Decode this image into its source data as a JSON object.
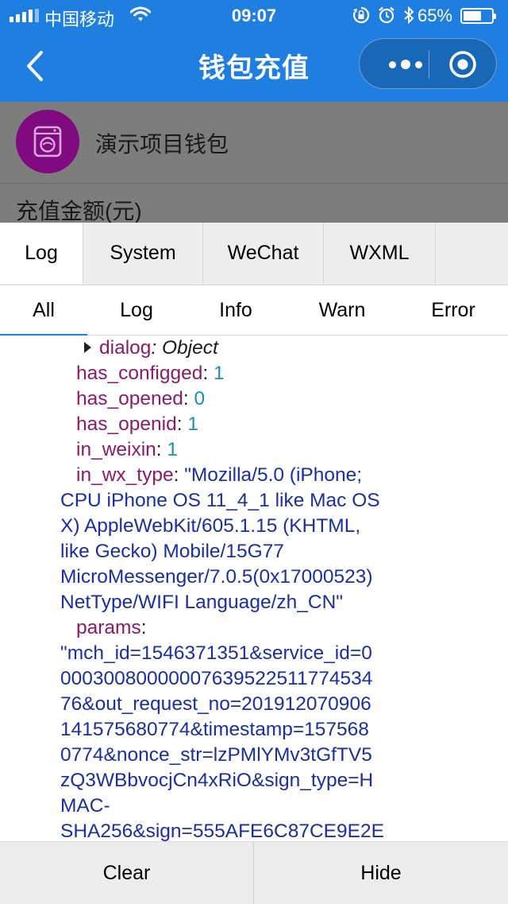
{
  "status_bar": {
    "carrier": "中国移动",
    "time": "09:07",
    "battery_percent": "65%",
    "battery_level": 0.65,
    "icons": [
      "signal-icon",
      "wifi-icon",
      "rotation-lock-icon",
      "alarm-icon",
      "bluetooth-icon",
      "battery-icon"
    ]
  },
  "nav": {
    "title": "钱包充值",
    "back_icon": "chevron-left-icon",
    "more_icon": "more-dots-icon",
    "close_icon": "target-circle-icon"
  },
  "page": {
    "wallet_name": "演示项目钱包",
    "amount_label": "充值金额(元)"
  },
  "vconsole": {
    "tabs": [
      {
        "label": "Log"
      },
      {
        "label": "System"
      },
      {
        "label": "WeChat"
      },
      {
        "label": "WXML"
      }
    ],
    "subtabs": [
      {
        "label": "All"
      },
      {
        "label": "Log"
      },
      {
        "label": "Info"
      },
      {
        "label": "Warn"
      },
      {
        "label": "Error"
      }
    ],
    "log": {
      "dialog_key": "dialog",
      "dialog_type": ": Object",
      "entries": [
        {
          "key": "has_configged",
          "value": "1"
        },
        {
          "key": "has_opened",
          "value": "0"
        },
        {
          "key": "has_openid",
          "value": "1"
        },
        {
          "key": "in_weixin",
          "value": "1"
        }
      ],
      "ua_key": "in_wx_type",
      "ua_lines": [
        "\"Mozilla/5.0 (iPhone;",
        "CPU iPhone OS 11_4_1 like Mac OS",
        "X) AppleWebKit/605.1.15 (KHTML,",
        "like Gecko) Mobile/15G77",
        "MicroMessenger/7.0.5(0x17000523)",
        "NetType/WIFI Language/zh_CN\""
      ],
      "params_key": "params",
      "params_lines": [
        "\"mch_id=1546371351&service_id=0",
        "00030080000007639522511774534",
        "76&out_request_no=201912070906",
        "141575680774&timestamp=157568",
        "0774&nonce_str=lzPMlYMv3tGfTV5",
        "zQ3WBbvocjCn4xRiO&sign_type=H",
        "MAC-",
        "SHA256&sign=555AFE6C87CE9E2E"
      ]
    },
    "footer": {
      "clear_label": "Clear",
      "hide_label": "Hide"
    }
  }
}
